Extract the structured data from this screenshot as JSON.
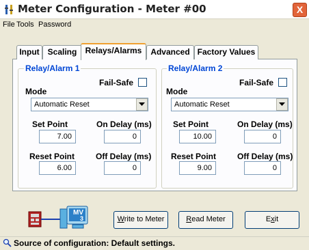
{
  "window": {
    "title": "Meter Configuration - Meter #00",
    "close_label": "X"
  },
  "menu": {
    "items": [
      "File",
      "Tools",
      "Password"
    ]
  },
  "tabs": [
    "Input",
    "Scaling",
    "Relays/Alarms",
    "Advanced",
    "Factory Values"
  ],
  "active_tab": "Relays/Alarms",
  "relay1": {
    "title": "Relay/Alarm 1",
    "failsafe_label": "Fail-Safe",
    "mode_label": "Mode",
    "mode_value": "Automatic Reset",
    "set_point_label": "Set Point",
    "set_point_value": "7.00",
    "on_delay_label": "On Delay (ms)",
    "on_delay_value": "0",
    "reset_point_label": "Reset Point",
    "reset_point_value": "6.00",
    "off_delay_label": "Off Delay (ms)",
    "off_delay_value": "0"
  },
  "relay2": {
    "title": "Relay/Alarm 2",
    "failsafe_label": "Fail-Safe",
    "mode_label": "Mode",
    "mode_value": "Automatic Reset",
    "set_point_label": "Set Point",
    "set_point_value": "10.00",
    "on_delay_label": "On Delay (ms)",
    "on_delay_value": "0",
    "reset_point_label": "Reset Point",
    "reset_point_value": "9.00",
    "off_delay_label": "Off Delay (ms)",
    "off_delay_value": "0"
  },
  "buttons": {
    "write_prefix": "",
    "write_hot": "W",
    "write_rest": "rite to Meter",
    "read_prefix": "",
    "read_hot": "R",
    "read_rest": "ead Meter",
    "exit_prefix": "E",
    "exit_hot": "x",
    "exit_rest": "it"
  },
  "icon_label": "MV",
  "icon_sub": "3",
  "status": {
    "text": "Source of configuration: Default settings."
  },
  "colors": {
    "accent": "#0046d5",
    "close": "#e2643a",
    "tab_highlight": "#f0a030"
  }
}
